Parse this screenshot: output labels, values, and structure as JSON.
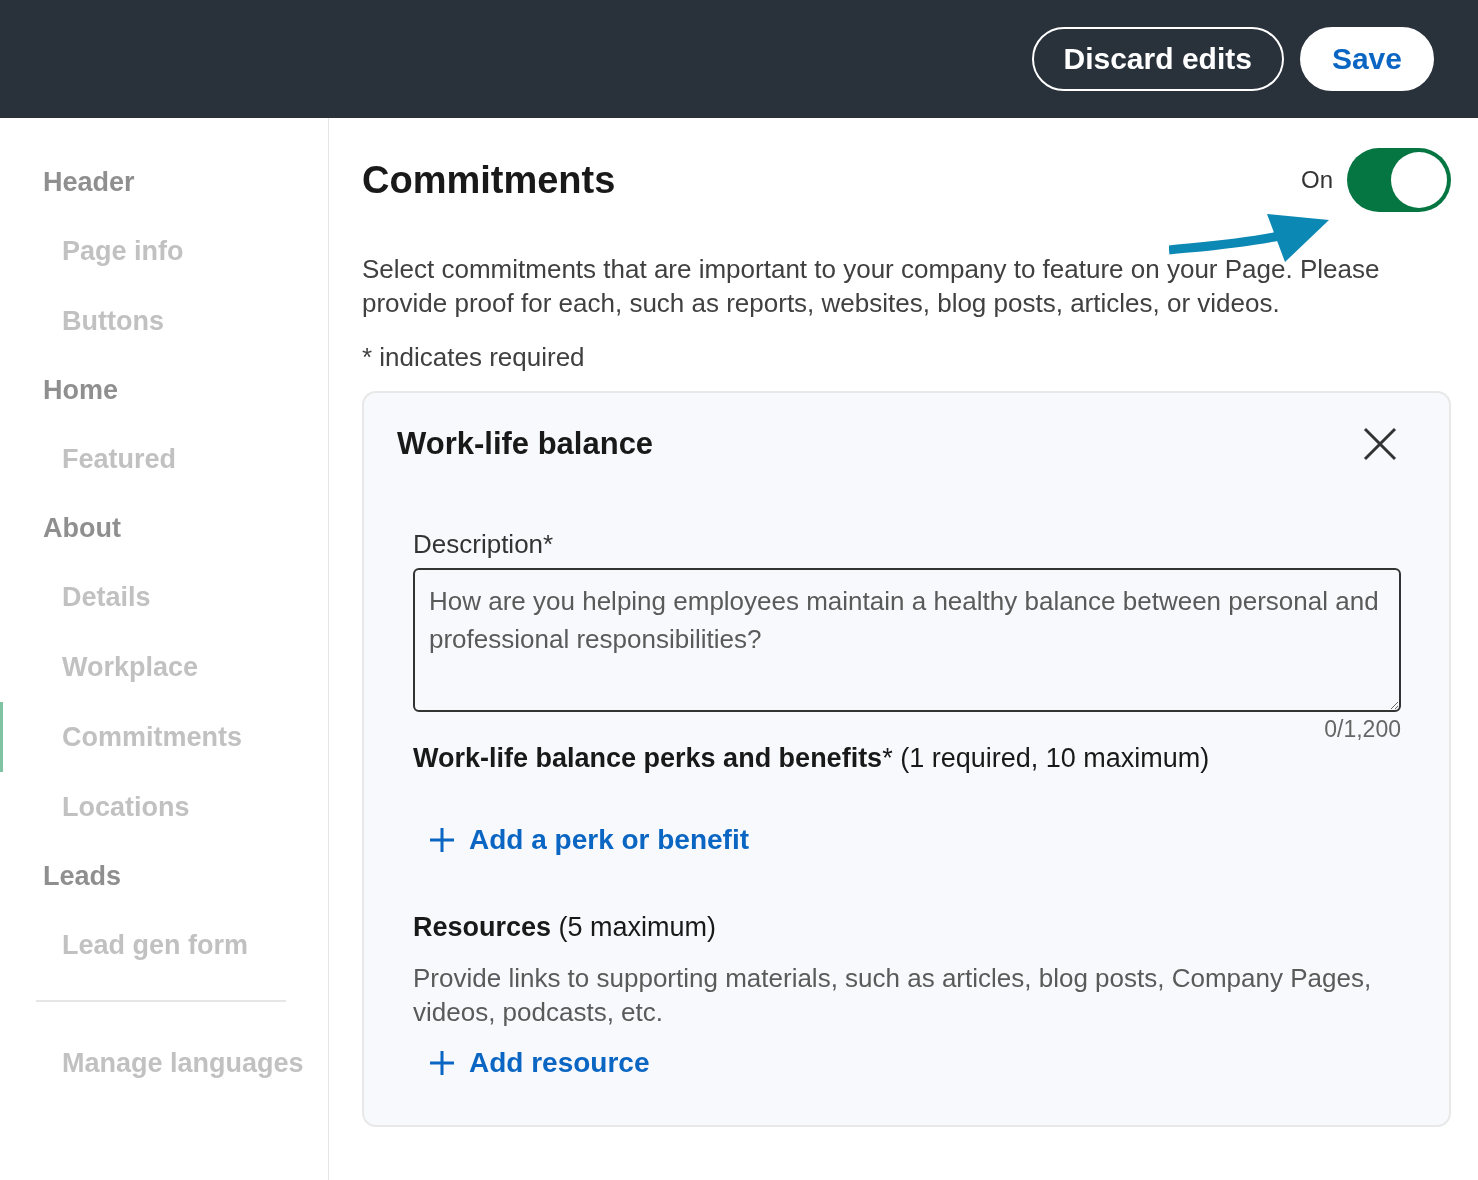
{
  "top_bar": {
    "buttons": [
      {
        "label": "Discard edits",
        "kind": "outline"
      },
      {
        "label": "Save",
        "kind": "primary"
      }
    ]
  },
  "sidebar": {
    "sections": [
      {
        "label": "Header",
        "children": [
          {
            "label": "Page info",
            "selected": false
          },
          {
            "label": "Buttons",
            "selected": false
          }
        ]
      },
      {
        "label": "Home",
        "children": [
          {
            "label": "Featured",
            "selected": false
          }
        ]
      },
      {
        "label": "About",
        "children": [
          {
            "label": "Details",
            "selected": false
          },
          {
            "label": "Workplace",
            "selected": false
          },
          {
            "label": "Commitments",
            "selected": true
          },
          {
            "label": "Locations",
            "selected": false
          }
        ]
      },
      {
        "label": "Leads",
        "children": [
          {
            "label": "Lead gen form",
            "selected": false
          }
        ]
      }
    ],
    "footer_link": "Manage languages"
  },
  "main": {
    "title": "Commitments",
    "toggle": {
      "label": "On",
      "on": true
    },
    "description": "Select commitments that are important to your company to feature on your Page. Please provide proof for each, such as reports, websites, blog posts, articles, or videos.",
    "required_note": "* indicates required",
    "card": {
      "title": "Work-life balance",
      "description_field": {
        "label": "Description*",
        "placeholder": "How are you helping employees maintain a healthy balance between personal and professional responsibilities?",
        "counter": "0/1,200"
      },
      "perks": {
        "label": "**Work-life balance perks and benefits*** (1 required, 10 maximum)",
        "action": "Add a perk or benefit"
      },
      "resources": {
        "label": "**Resources** (5 maximum)",
        "help": "Provide links to supporting materials, such as articles, blog posts, Company Pages, videos, podcasts, etc.",
        "action": "Add resource"
      }
    }
  }
}
